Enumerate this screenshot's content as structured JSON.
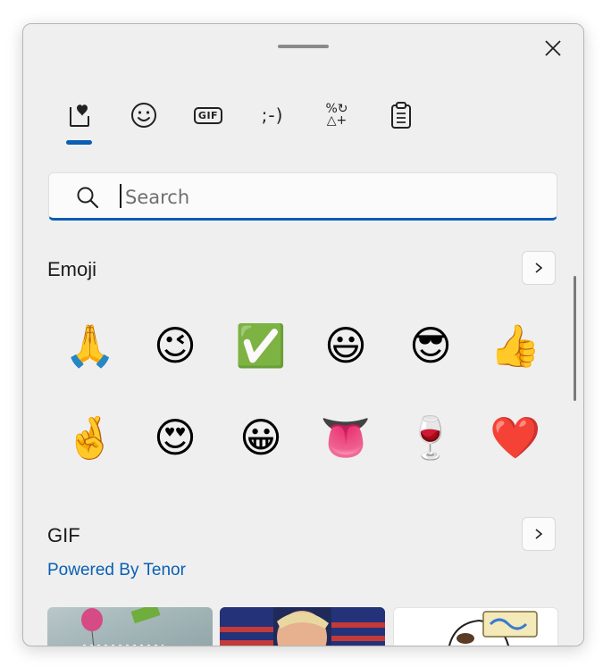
{
  "window": {
    "close_label": "×"
  },
  "tabs": [
    {
      "name": "favorites",
      "icon": "heart-in-box-icon"
    },
    {
      "name": "emoji",
      "icon": "smiley-icon"
    },
    {
      "name": "gif",
      "icon": "gif-icon",
      "glyph": "GIF"
    },
    {
      "name": "kaomoji",
      "icon": "emoticon-icon",
      "glyph": ";-)"
    },
    {
      "name": "symbols",
      "icon": "symbols-icon",
      "glyph_top": "%↻",
      "glyph_bottom": "△+"
    },
    {
      "name": "clipboard",
      "icon": "clipboard-icon"
    }
  ],
  "search": {
    "placeholder": "Search",
    "value": ""
  },
  "emoji_section": {
    "title": "Emoji",
    "more_label": "›",
    "items": [
      {
        "name": "folded-hands",
        "char": "🙏"
      },
      {
        "name": "winking-face",
        "char": "😉"
      },
      {
        "name": "check-mark-button",
        "char": "✅"
      },
      {
        "name": "grinning-face-big-eyes",
        "char": "😃"
      },
      {
        "name": "smiling-face-sunglasses",
        "char": "😎"
      },
      {
        "name": "thumbs-up",
        "char": "👍"
      },
      {
        "name": "crossed-fingers",
        "char": "🤞"
      },
      {
        "name": "heart-eyes",
        "char": "😍"
      },
      {
        "name": "grinning-face",
        "char": "😀"
      },
      {
        "name": "tongue",
        "char": "👅"
      },
      {
        "name": "wine-glass",
        "char": "🍷"
      },
      {
        "name": "red-heart",
        "char": "❤️"
      }
    ]
  },
  "gif_section": {
    "title": "GIF",
    "more_label": "›",
    "powered_by": "Powered By Tenor"
  },
  "colors": {
    "accent": "#0a5fb4",
    "panel_bg": "#efefef"
  }
}
